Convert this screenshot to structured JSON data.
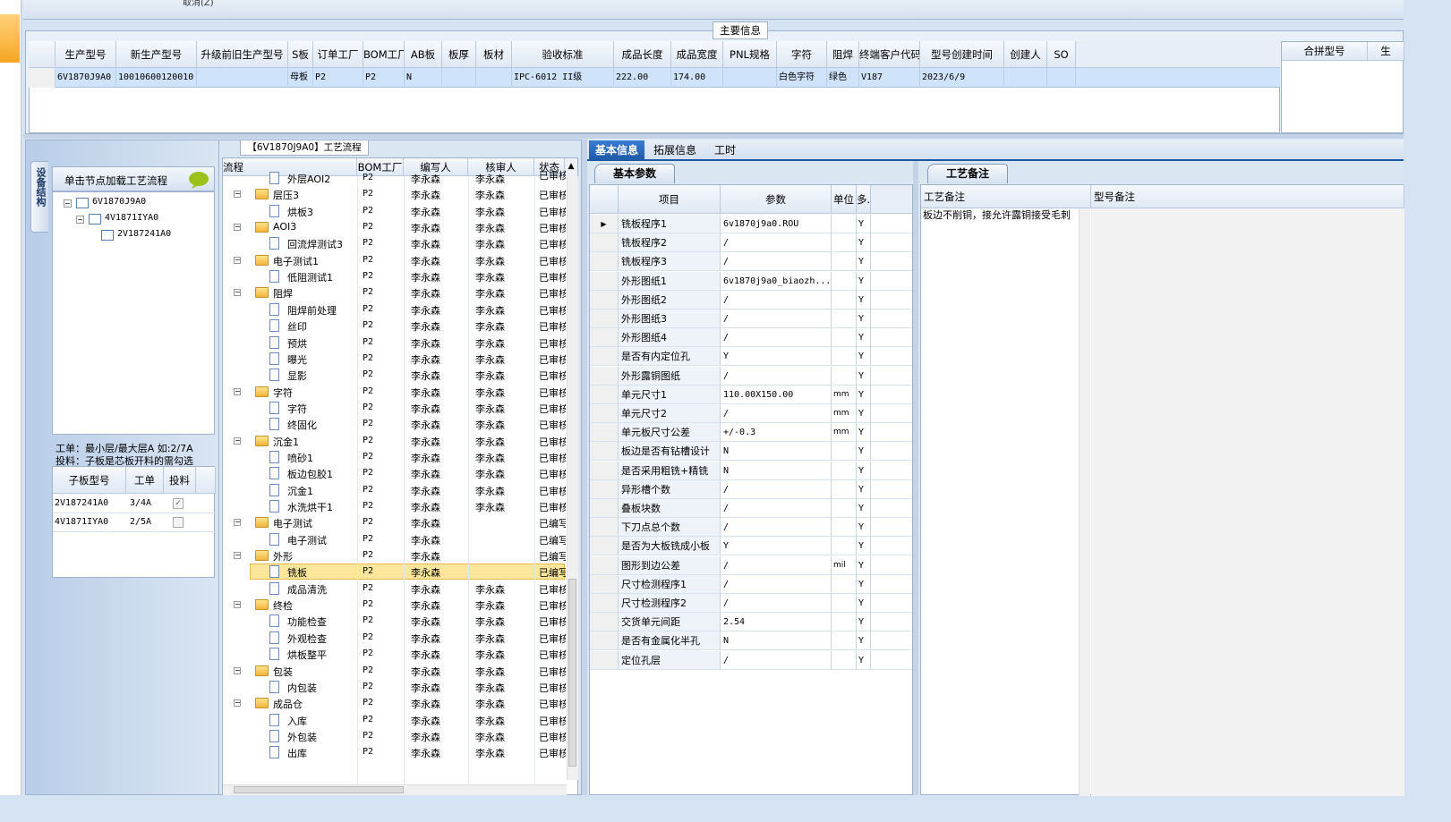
{
  "top": {
    "cancel_label": "取消(Z)"
  },
  "main_info": {
    "title": "主要信息",
    "columns": [
      "生产型号",
      "新生产型号",
      "升级前旧生产型号",
      "S板",
      "订单工厂",
      "BOM工厂",
      "AB板",
      "板厚",
      "板材",
      "验收标准",
      "成品长度",
      "成品宽度",
      "PNL规格",
      "字符",
      "阻焊",
      "终端客户代码",
      "型号创建时间",
      "创建人",
      "SO"
    ],
    "row": [
      "6V1870J9A0",
      "10010600120010",
      "",
      "母板",
      "P2",
      "P2",
      "N",
      "",
      "",
      "IPC-6012 II级",
      "222.00",
      "174.00",
      "",
      "白色字符",
      "绿色",
      "V187",
      "2023/6/9",
      "",
      ""
    ],
    "merge_header": "合拼型号",
    "merge_header2": "生"
  },
  "structure": {
    "tab_label": "设备结构",
    "tip": "单击节点加载工艺流程",
    "tree": [
      {
        "label": "6V1870J9A0",
        "level": 0
      },
      {
        "label": "4V1871IYA0",
        "level": 1
      },
      {
        "label": "2V187241A0",
        "level": 2
      }
    ],
    "note1": "工单：最小层/最大层A 如:2/7A",
    "note2": "投料：子板是芯板开料的需勾选",
    "sub_columns": [
      "子板型号",
      "工单",
      "投料"
    ],
    "sub_rows": [
      {
        "model": "2V187241A0",
        "wo": "3/4A",
        "checked": true
      },
      {
        "model": "4V1871IYA0",
        "wo": "2/5A",
        "checked": false
      }
    ]
  },
  "process": {
    "title": "【6V1870J9A0】工艺流程",
    "columns": [
      "流程",
      "BOM工厂",
      "编写人",
      "核审人",
      "状态"
    ],
    "rows": [
      {
        "name": "外层AOI2",
        "folder": false,
        "f": "P2",
        "w": "李永森",
        "r": "李永森",
        "s": "已审核",
        "partial": true
      },
      {
        "name": "层压3",
        "folder": true,
        "f": "P2",
        "w": "李永森",
        "r": "李永森",
        "s": "已审核"
      },
      {
        "name": "烘板3",
        "folder": false,
        "f": "P2",
        "w": "李永森",
        "r": "李永森",
        "s": "已审核"
      },
      {
        "name": "AOI3",
        "folder": true,
        "f": "P2",
        "w": "李永森",
        "r": "李永森",
        "s": "已审核"
      },
      {
        "name": "回流焊测试3",
        "folder": false,
        "f": "P2",
        "w": "李永森",
        "r": "李永森",
        "s": "已审核"
      },
      {
        "name": "电子测试1",
        "folder": true,
        "f": "P2",
        "w": "李永森",
        "r": "李永森",
        "s": "已审核"
      },
      {
        "name": "低阻测试1",
        "folder": false,
        "f": "P2",
        "w": "李永森",
        "r": "李永森",
        "s": "已审核"
      },
      {
        "name": "阻焊",
        "folder": true,
        "f": "P2",
        "w": "李永森",
        "r": "李永森",
        "s": "已审核"
      },
      {
        "name": "阻焊前处理",
        "folder": false,
        "f": "P2",
        "w": "李永森",
        "r": "李永森",
        "s": "已审核"
      },
      {
        "name": "丝印",
        "folder": false,
        "f": "P2",
        "w": "李永森",
        "r": "李永森",
        "s": "已审核"
      },
      {
        "name": "预烘",
        "folder": false,
        "f": "P2",
        "w": "李永森",
        "r": "李永森",
        "s": "已审核"
      },
      {
        "name": "曝光",
        "folder": false,
        "f": "P2",
        "w": "李永森",
        "r": "李永森",
        "s": "已审核"
      },
      {
        "name": "显影",
        "folder": false,
        "f": "P2",
        "w": "李永森",
        "r": "李永森",
        "s": "已审核"
      },
      {
        "name": "字符",
        "folder": true,
        "f": "P2",
        "w": "李永森",
        "r": "李永森",
        "s": "已审核"
      },
      {
        "name": "字符",
        "folder": false,
        "f": "P2",
        "w": "李永森",
        "r": "李永森",
        "s": "已审核"
      },
      {
        "name": "终固化",
        "folder": false,
        "f": "P2",
        "w": "李永森",
        "r": "李永森",
        "s": "已审核"
      },
      {
        "name": "沉金1",
        "folder": true,
        "f": "P2",
        "w": "李永森",
        "r": "李永森",
        "s": "已审核"
      },
      {
        "name": "喷砂1",
        "folder": false,
        "f": "P2",
        "w": "李永森",
        "r": "李永森",
        "s": "已审核"
      },
      {
        "name": "板边包胶1",
        "folder": false,
        "f": "P2",
        "w": "李永森",
        "r": "李永森",
        "s": "已审核"
      },
      {
        "name": "沉金1",
        "folder": false,
        "f": "P2",
        "w": "李永森",
        "r": "李永森",
        "s": "已审核"
      },
      {
        "name": "水洗烘干1",
        "folder": false,
        "f": "P2",
        "w": "李永森",
        "r": "李永森",
        "s": "已审核"
      },
      {
        "name": "电子测试",
        "folder": true,
        "f": "P2",
        "w": "李永森",
        "r": "",
        "s": "已编写"
      },
      {
        "name": "电子测试",
        "folder": false,
        "f": "P2",
        "w": "李永森",
        "r": "",
        "s": "已编写"
      },
      {
        "name": "外形",
        "folder": true,
        "f": "P2",
        "w": "李永森",
        "r": "",
        "s": "已编写"
      },
      {
        "name": "铣板",
        "folder": false,
        "f": "P2",
        "w": "李永森",
        "r": "",
        "s": "已编写",
        "selected": true
      },
      {
        "name": "成品清洗",
        "folder": false,
        "f": "P2",
        "w": "李永森",
        "r": "李永森",
        "s": "已审核"
      },
      {
        "name": "终检",
        "folder": true,
        "f": "P2",
        "w": "李永森",
        "r": "李永森",
        "s": "已审核"
      },
      {
        "name": "功能检查",
        "folder": false,
        "f": "P2",
        "w": "李永森",
        "r": "李永森",
        "s": "已审核"
      },
      {
        "name": "外观检查",
        "folder": false,
        "f": "P2",
        "w": "李永森",
        "r": "李永森",
        "s": "已审核"
      },
      {
        "name": "烘板整平",
        "folder": false,
        "f": "P2",
        "w": "李永森",
        "r": "李永森",
        "s": "已审核"
      },
      {
        "name": "包装",
        "folder": true,
        "f": "P2",
        "w": "李永森",
        "r": "李永森",
        "s": "已审核"
      },
      {
        "name": "内包装",
        "folder": false,
        "f": "P2",
        "w": "李永森",
        "r": "李永森",
        "s": "已审核"
      },
      {
        "name": "成品仓",
        "folder": true,
        "f": "P2",
        "w": "李永森",
        "r": "李永森",
        "s": "已审核"
      },
      {
        "name": "入库",
        "folder": false,
        "f": "P2",
        "w": "李永森",
        "r": "李永森",
        "s": "已审核"
      },
      {
        "name": "外包装",
        "folder": false,
        "f": "P2",
        "w": "李永森",
        "r": "李永森",
        "s": "已审核"
      },
      {
        "name": "出库",
        "folder": false,
        "f": "P2",
        "w": "李永森",
        "r": "李永森",
        "s": "已审核"
      }
    ]
  },
  "details": {
    "tabs": [
      "基本信息",
      "拓展信息",
      "工时"
    ],
    "sub_tab": "基本参数",
    "columns": [
      "项目",
      "参数",
      "单位",
      "多.."
    ],
    "rows": [
      {
        "item": "铣板程序1",
        "param": "6v1870j9a0.ROU",
        "unit": "",
        "y": "Y"
      },
      {
        "item": "铣板程序2",
        "param": "/",
        "unit": "",
        "y": "Y"
      },
      {
        "item": "铣板程序3",
        "param": "/",
        "unit": "",
        "y": "Y"
      },
      {
        "item": "外形图纸1",
        "param": "6v1870j9a0_biaozh...",
        "unit": "",
        "y": "Y"
      },
      {
        "item": "外形图纸2",
        "param": "/",
        "unit": "",
        "y": "Y"
      },
      {
        "item": "外形图纸3",
        "param": "/",
        "unit": "",
        "y": "Y"
      },
      {
        "item": "外形图纸4",
        "param": "/",
        "unit": "",
        "y": "Y"
      },
      {
        "item": "是否有内定位孔",
        "param": "Y",
        "unit": "",
        "y": "Y"
      },
      {
        "item": "外形露铜图纸",
        "param": "/",
        "unit": "",
        "y": "Y"
      },
      {
        "item": "单元尺寸1",
        "param": "110.00X150.00",
        "unit": "mm",
        "y": "Y"
      },
      {
        "item": "单元尺寸2",
        "param": "/",
        "unit": "mm",
        "y": "Y"
      },
      {
        "item": "单元板尺寸公差",
        "param": "+/-0.3",
        "unit": "mm",
        "y": "Y"
      },
      {
        "item": "板边是否有钻槽设计",
        "param": "N",
        "unit": "",
        "y": "Y"
      },
      {
        "item": "是否采用粗铣+精铣",
        "param": "N",
        "unit": "",
        "y": "Y"
      },
      {
        "item": "异形槽个数",
        "param": "/",
        "unit": "",
        "y": "Y"
      },
      {
        "item": "叠板块数",
        "param": "/",
        "unit": "",
        "y": "Y"
      },
      {
        "item": "下刀点总个数",
        "param": "/",
        "unit": "",
        "y": "Y"
      },
      {
        "item": "是否为大板铣成小板",
        "param": "Y",
        "unit": "",
        "y": "Y"
      },
      {
        "item": "图形到边公差",
        "param": "/",
        "unit": "mil",
        "y": "Y"
      },
      {
        "item": "尺寸检测程序1",
        "param": "/",
        "unit": "",
        "y": "Y"
      },
      {
        "item": "尺寸检测程序2",
        "param": "/",
        "unit": "",
        "y": "Y"
      },
      {
        "item": "交货单元间距",
        "param": "2.54",
        "unit": "",
        "y": "Y"
      },
      {
        "item": "是否有金属化半孔",
        "param": "N",
        "unit": "",
        "y": "Y"
      },
      {
        "item": "定位孔层",
        "param": "/",
        "unit": "",
        "y": "Y"
      }
    ]
  },
  "notes": {
    "tab": "工艺备注",
    "col1": "工艺备注",
    "col2": "型号备注",
    "text": "板边不削铜，接允许露铜接受毛刺"
  }
}
